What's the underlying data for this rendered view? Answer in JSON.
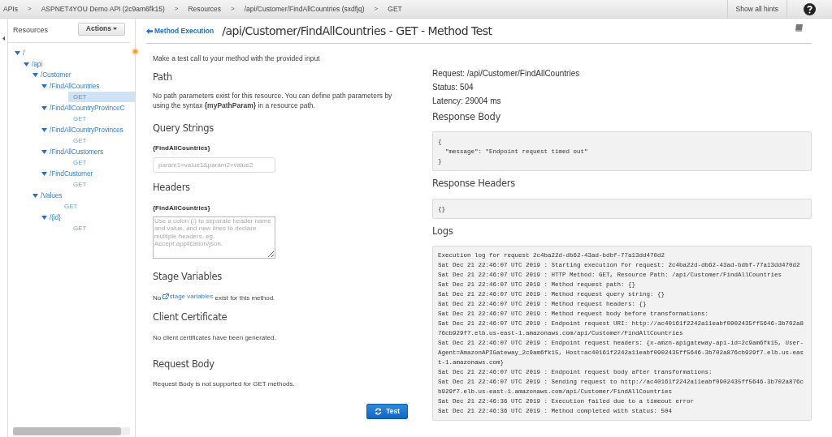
{
  "breadcrumbs": [
    "APIs",
    "ASPNET4YOU Demo API (2c9am6fk15)",
    "Resources",
    "/api/Customer/FindAllCountries (sxdfjq)",
    "GET"
  ],
  "breadcrumb_separator": ">",
  "hints_button": "Show all hints",
  "sidebar": {
    "title": "Resources",
    "actions_button": "Actions",
    "tree": [
      {
        "kind": "resource",
        "label": "/",
        "expanded": true,
        "children": [
          {
            "kind": "resource",
            "label": "/api",
            "expanded": true,
            "children": [
              {
                "kind": "resource",
                "label": "/Customer",
                "expanded": true,
                "children": [
                  {
                    "kind": "resource",
                    "label": "/FindAllCountries",
                    "expanded": true,
                    "children": [
                      {
                        "kind": "method",
                        "label": "GET",
                        "selected": true
                      }
                    ]
                  },
                  {
                    "kind": "resource",
                    "label": "/FindAllCountryProvinceC",
                    "expanded": true,
                    "children": [
                      {
                        "kind": "method",
                        "label": "GET",
                        "selected": false
                      }
                    ]
                  },
                  {
                    "kind": "resource",
                    "label": "/FindAllCountryProvinces",
                    "expanded": true,
                    "children": [
                      {
                        "kind": "method",
                        "label": "GET",
                        "selected": false
                      }
                    ]
                  },
                  {
                    "kind": "resource",
                    "label": "/FindAllCustomers",
                    "expanded": true,
                    "children": [
                      {
                        "kind": "method",
                        "label": "GET",
                        "selected": false
                      }
                    ]
                  },
                  {
                    "kind": "resource",
                    "label": "/FindCustomer",
                    "expanded": true,
                    "children": [
                      {
                        "kind": "method",
                        "label": "GET",
                        "selected": false
                      }
                    ]
                  }
                ]
              },
              {
                "kind": "resource",
                "label": "/Values",
                "expanded": true,
                "children": [
                  {
                    "kind": "method",
                    "label": "GET",
                    "selected": false
                  },
                  {
                    "kind": "resource",
                    "label": "/{id}",
                    "expanded": true,
                    "children": [
                      {
                        "kind": "method",
                        "label": "GET",
                        "selected": false
                      }
                    ]
                  }
                ]
              }
            ]
          }
        ]
      }
    ]
  },
  "back_link": "Method Execution",
  "page_title": "/api/Customer/FindAllCountries - GET - Method Test",
  "intro": "Make a test call to your method with the provided input",
  "path": {
    "heading": "Path",
    "text": "No path parameters exist for this resource. You can define path parameters by using the syntax **{myPathParam}** in a resource path."
  },
  "query_strings": {
    "heading": "Query Strings",
    "label": "{FindAllCountries}",
    "placeholder": "param1=value1&param2=value2"
  },
  "headers": {
    "heading": "Headers",
    "label": "{FindAllCountries}",
    "placeholder": "Use a colon (:) to separate header name and value, and new lines to declare multiple headers. eg. Accept:application/json."
  },
  "stage_variables": {
    "heading": "Stage Variables",
    "before": "No",
    "link": "stage variables",
    "after": "exist for this method."
  },
  "client_certificate": {
    "heading": "Client Certificate",
    "text": "No client certificates have been generated."
  },
  "request_body": {
    "heading": "Request Body",
    "text": "Request Body is not supported for GET methods."
  },
  "test_button": "Test",
  "result": {
    "request": "Request: /api/Customer/FindAllCountries",
    "status": "Status: 504",
    "latency": "Latency: 29004 ms",
    "response_body_heading": "Response Body",
    "response_body": [
      "{",
      "  \"message\": \"Endpoint request timed out\"",
      "}"
    ],
    "response_headers_heading": "Response Headers",
    "response_headers": "{}",
    "logs_heading": "Logs",
    "logs": [
      "Execution log for request 2c4ba22d-db62-43ad-bdbf-77a13dd470d2",
      "Sat Dec 21 22:46:07 UTC 2019 : Starting execution for request: 2c4ba22d-db62-43ad-bdbf-77a13dd470d2",
      "Sat Dec 21 22:46:07 UTC 2019 : HTTP Method: GET, Resource Path: /api/Customer/FindAllCountries",
      "Sat Dec 21 22:46:07 UTC 2019 : Method request path: {}",
      "Sat Dec 21 22:46:07 UTC 2019 : Method request query string: {}",
      "Sat Dec 21 22:46:07 UTC 2019 : Method request headers: {}",
      "Sat Dec 21 22:46:07 UTC 2019 : Method request body before transformations:",
      "Sat Dec 21 22:46:07 UTC 2019 : Endpoint request URI: http://ac40161f2242a11eabf0902435ff5646-3b702a876cb929f7.elb.us-east-1.amazonaws.com/api/Customer/FindAllCountries",
      "Sat Dec 21 22:46:07 UTC 2019 : Endpoint request headers: {x-amzn-apigateway-api-id=2c9am6fk15, User-Agent=AmazonAPIGateway_2c9am6fk15, Host=ac40161f2242a11eabf0902435ff5646-3b702a876cb929f7.elb.us-east-1.amazonaws.com}",
      "Sat Dec 21 22:46:07 UTC 2019 : Endpoint request body after transformations:",
      "Sat Dec 21 22:46:07 UTC 2019 : Sending request to http://ac40161f2242a11eabf0902435ff5646-3b702a876cb929f7.elb.us-east-1.amazonaws.com/api/Customer/FindAllCountries",
      "Sat Dec 21 22:46:36 UTC 2019 : Execution failed due to a timeout error",
      "Sat Dec 21 22:46:36 UTC 2019 : Method completed with status: 504"
    ]
  }
}
